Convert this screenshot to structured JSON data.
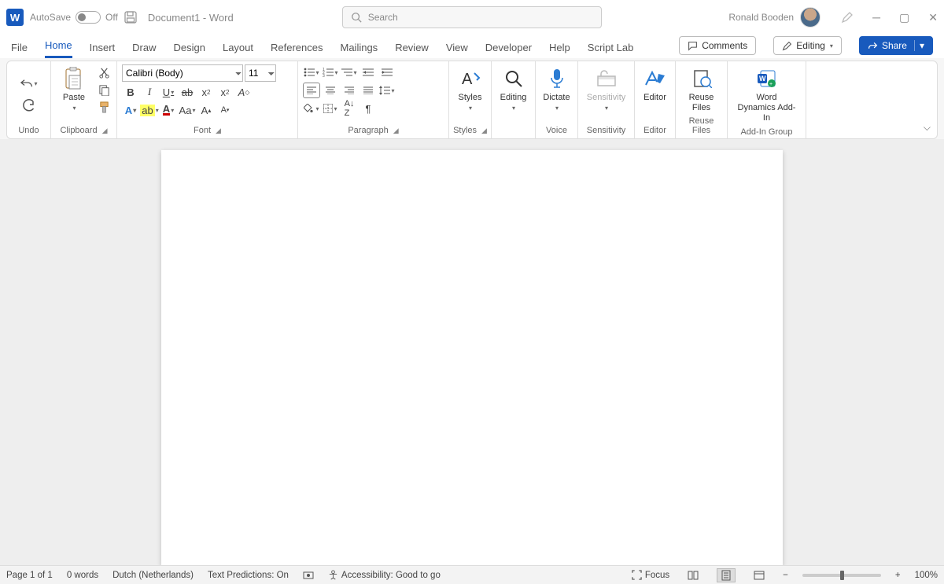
{
  "titlebar": {
    "autosave_label": "AutoSave",
    "autosave_state": "Off",
    "document_title": "Document1  -  Word",
    "search_placeholder": "Search",
    "user_name": "Ronald Booden"
  },
  "tabs": {
    "items": [
      "File",
      "Home",
      "Insert",
      "Draw",
      "Design",
      "Layout",
      "References",
      "Mailings",
      "Review",
      "View",
      "Developer",
      "Help",
      "Script Lab"
    ],
    "active": "Home",
    "comments": "Comments",
    "editing": "Editing",
    "share": "Share"
  },
  "ribbon": {
    "undo": {
      "label": "Undo"
    },
    "clipboard": {
      "label": "Clipboard",
      "paste": "Paste"
    },
    "font": {
      "label": "Font",
      "name": "Calibri (Body)",
      "size": "11"
    },
    "paragraph": {
      "label": "Paragraph"
    },
    "styles": {
      "label": "Styles",
      "btn": "Styles"
    },
    "editing": {
      "label": "Editing",
      "btn": "Editing"
    },
    "voice": {
      "label": "Voice",
      "btn": "Dictate"
    },
    "sensitivity": {
      "label": "Sensitivity",
      "btn": "Sensitivity"
    },
    "editor": {
      "label": "Editor",
      "btn": "Editor"
    },
    "reuse": {
      "label": "Reuse Files",
      "btn": "Reuse Files"
    },
    "addin": {
      "label": "Add-In Group",
      "btn": "Word Dynamics Add-In"
    }
  },
  "statusbar": {
    "page": "Page 1 of 1",
    "words": "0 words",
    "language": "Dutch (Netherlands)",
    "predictions": "Text Predictions: On",
    "accessibility": "Accessibility: Good to go",
    "focus": "Focus",
    "zoom": "100%"
  }
}
